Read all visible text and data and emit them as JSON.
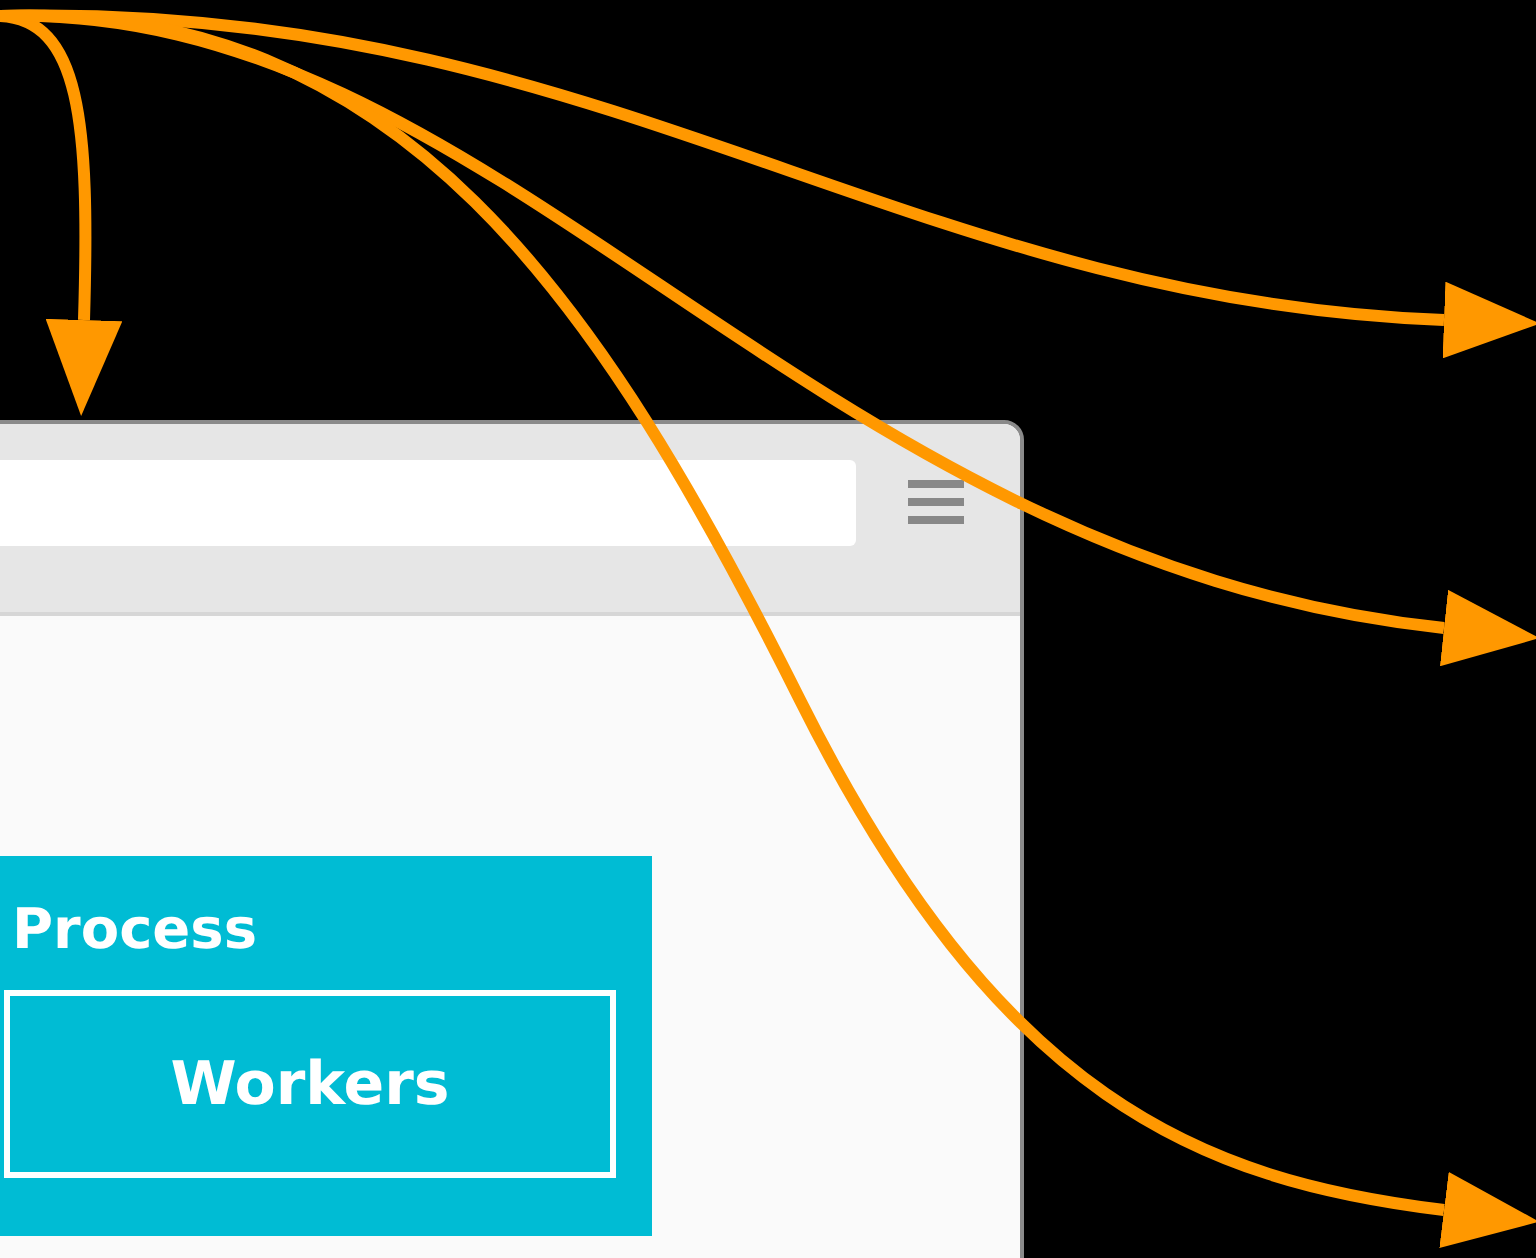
{
  "panel": {
    "title": "Process",
    "button": "Workers"
  }
}
